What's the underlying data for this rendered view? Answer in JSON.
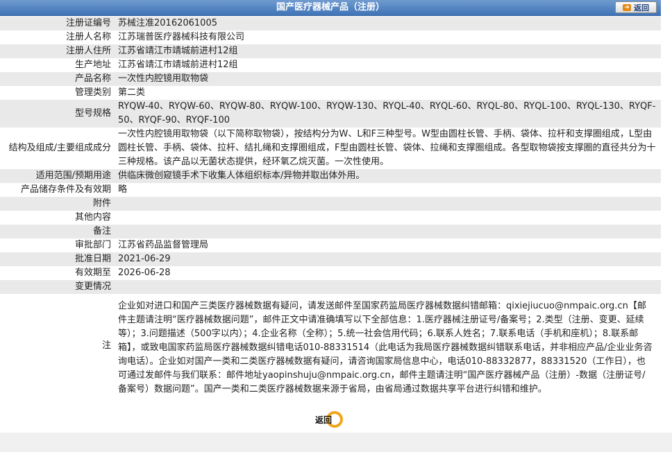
{
  "header": {
    "title": "国产医疗器械产品（注册）",
    "back_label": "返回"
  },
  "rows": [
    {
      "label": "注册证编号",
      "value": "苏械注准20162061005"
    },
    {
      "label": "注册人名称",
      "value": "江苏瑞普医疗器械科技有限公司"
    },
    {
      "label": "注册人住所",
      "value": "江苏省靖江市靖城前进村12组"
    },
    {
      "label": "生产地址",
      "value": "江苏省靖江市靖城前进村12组"
    },
    {
      "label": "产品名称",
      "value": "一次性内腔镜用取物袋"
    },
    {
      "label": "管理类别",
      "value": "第二类"
    },
    {
      "label": "型号规格",
      "value": "RYQW-40、RYQW-60、RYQW-80、RYQW-100、RYQW-130、RYQL-40、RYQL-60、RYQL-80、RYQL-100、RYQL-130、RYQF-50、RYQF-90、RYQF-100"
    },
    {
      "label": "结构及组成/主要组成成分",
      "value": "一次性内腔镜用取物袋（以下简称取物袋），按结构分为W、L和F三种型号。W型由圆柱长管、手柄、袋体、拉杆和支撑圈组成，L型由圆柱长管、手柄、袋体、拉杆、结扎绳和支撑圈组成，F型由圆柱长管、袋体、拉绳和支撑圈组成。各型取物袋按支撑圈的直径共分为十三种规格。该产品以无菌状态提供，经环氧乙烷灭菌。一次性使用。"
    },
    {
      "label": "适用范围/预期用途",
      "value": "供临床微创窥镜手术下收集人体组织标本/异物并取出体外用。"
    },
    {
      "label": "产品储存条件及有效期",
      "value": "略"
    },
    {
      "label": "附件",
      "value": ""
    },
    {
      "label": "其他内容",
      "value": ""
    },
    {
      "label": "备注",
      "value": ""
    },
    {
      "label": "审批部门",
      "value": "江苏省药品监督管理局"
    },
    {
      "label": "批准日期",
      "value": "2021-06-29"
    },
    {
      "label": "有效期至",
      "value": "2026-06-28"
    },
    {
      "label": "变更情况",
      "value": ""
    }
  ],
  "note": {
    "label": "注",
    "text": "企业如对进口和国产三类医疗器械数据有疑问，请发送邮件至国家药监局医疗器械数据纠错邮箱：qixiejiucuo@nmpaic.org.cn【邮件主题请注明“医疗器械数据问题”，邮件正文中请准确填写以下全部信息：1.医疗器械注册证号/备案号；2.类型（注册、变更、延续等）；3.问题描述（500字以内）；4.企业名称（全称）；5.统一社会信用代码；6.联系人姓名；7.联系电话（手机和座机）；8.联系邮箱】，或致电国家药监局医疗器械数据纠错电话010-88331514（此电话为我局医疗器械数据纠错联系电话，并非相应产品/企业业务咨询电话）。企业如对国产一类和二类医疗器械数据有疑问，请咨询国家局信息中心，电话010-88332877，88331520（工作日），也可通过发邮件与我们联系：邮件地址yaopinshuju@nmpaic.org.cn，邮件主题请注明“国产医疗器械产品（注册）-数据（注册证号/备案号）数据问题”。国产一类和二类医疗器械数据来源于省局，由省局通过数据共享平台进行纠错和维护。"
  },
  "footer": {
    "back_label": "返回"
  },
  "colors": {
    "header_bg": "#4f80c0",
    "row_alt_bg": "#e9e9e9",
    "back_icon": "#f0a51b"
  }
}
